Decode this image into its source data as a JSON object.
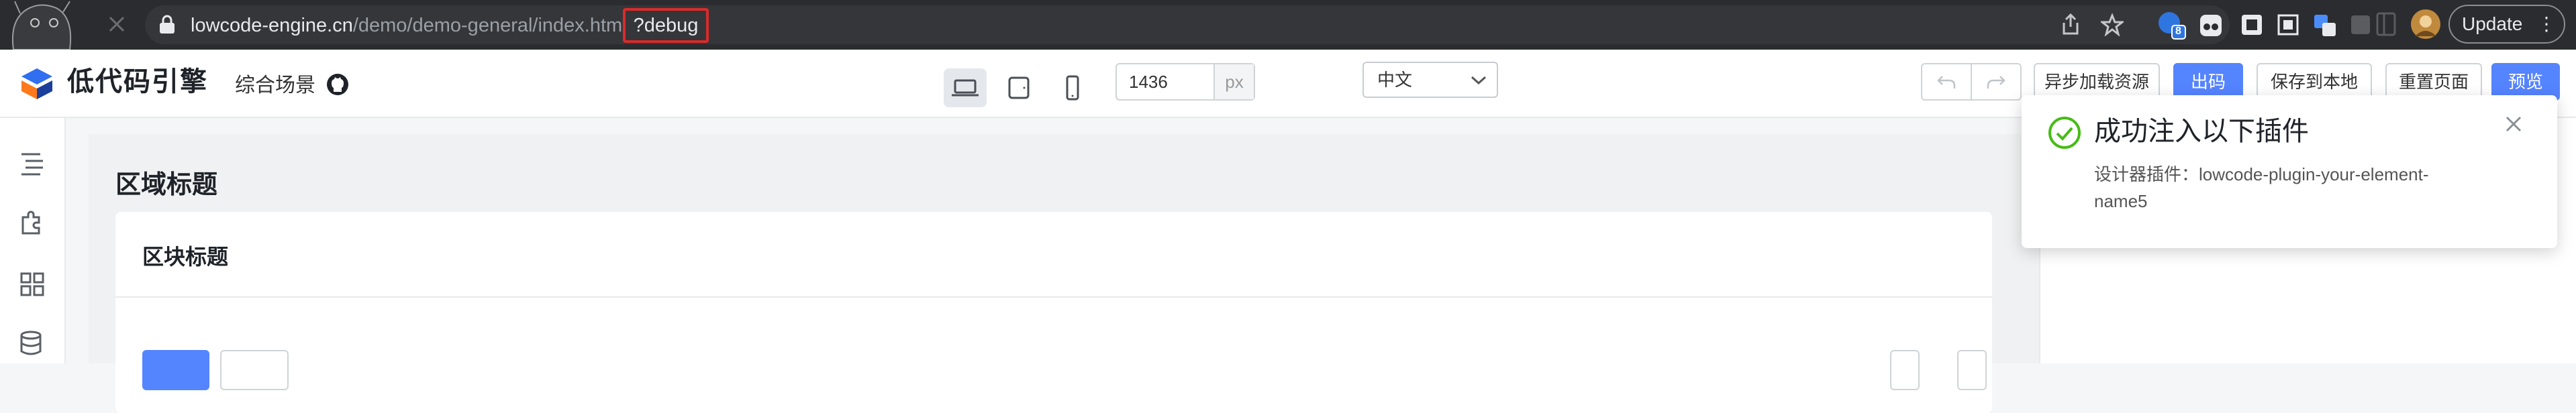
{
  "browser": {
    "url_host": "lowcode-engine.cn",
    "url_path": "/demo/demo-general/index.html",
    "url_query": "?debug",
    "update_label": "Update",
    "extension_badge": "8"
  },
  "topbar": {
    "logo_text": "低代码引擎",
    "scene_label": "综合场景",
    "width_value": "1436",
    "width_unit": "px",
    "locale_value": "中文",
    "buttons": {
      "async_load": "异步加载资源",
      "export": "出码",
      "save_local": "保存到本地",
      "reset": "重置页面",
      "preview": "预览"
    }
  },
  "canvas": {
    "area_title": "区域标题",
    "block_title": "区块标题"
  },
  "notification": {
    "title": "成功注入以下插件",
    "description": "设计器插件：lowcode-plugin-your-element-name5"
  },
  "colors": {
    "primary": "#5584ff",
    "success": "#46bc15",
    "highlight_border": "#d92b2b"
  }
}
